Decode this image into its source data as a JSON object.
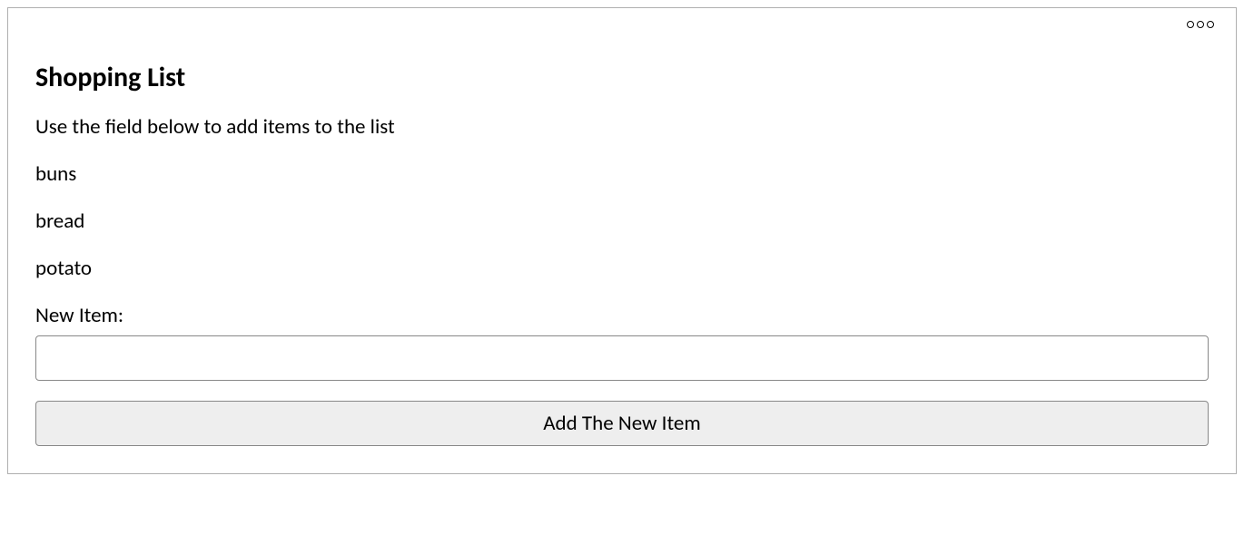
{
  "title": "Shopping List",
  "subtitle": "Use the field below to add items to the list",
  "items": [
    "buns",
    "bread",
    "potato"
  ],
  "new_item_label": "New Item:",
  "input_value": "",
  "add_button_label": "Add The New Item"
}
